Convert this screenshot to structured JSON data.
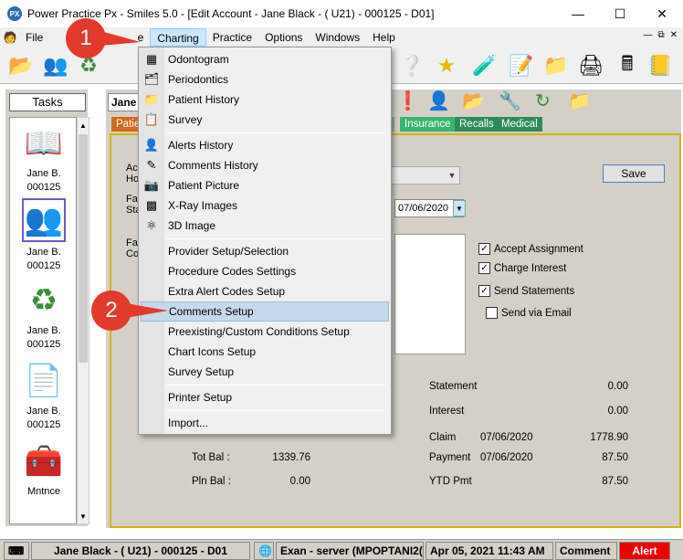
{
  "window": {
    "app_badge": "PX",
    "title": "Power Practice Px - Smiles 5.0 - [Edit Account - Jane Black - ( U21) - 000125 - D01]"
  },
  "menubar": {
    "items": [
      "File",
      "Edit",
      "Charting",
      "Practice",
      "Options",
      "Windows",
      "Help"
    ],
    "file_visible": "File",
    "edit_partial": "e",
    "active": "Charting"
  },
  "tasks": {
    "title": "Tasks",
    "items": [
      {
        "name": "Jane B.",
        "id": "000125",
        "icon": "ledger-book-icon"
      },
      {
        "name": "Jane B.",
        "id": "000125",
        "icon": "patients-icon"
      },
      {
        "name": "Jane B.",
        "id": "000125",
        "icon": "recycle-icon"
      },
      {
        "name": "Jane B.",
        "id": "000125",
        "icon": "document-icon"
      },
      {
        "name": "Mntnce",
        "id": "",
        "icon": "toolbox-icon"
      }
    ]
  },
  "main": {
    "patient_name": "Jane",
    "tabs": {
      "patient": "Patie",
      "r": "r",
      "insurance": "Insurance",
      "recalls": "Recalls",
      "medical": "Medical"
    },
    "fragments": {
      "ac": "Ac",
      "ho": "Ho",
      "fa1": "Fa",
      "sta": "Sta",
      "fa2": "Fa",
      "co": "Co"
    },
    "date_value": "07/06/2020",
    "save_label": "Save",
    "checkboxes": [
      {
        "label": "Accept Assignment",
        "checked": true
      },
      {
        "label": "Charge Interest",
        "checked": true
      },
      {
        "label": "Send Statements",
        "checked": true
      },
      {
        "label": "Send via Email",
        "checked": false
      }
    ],
    "balances": {
      "tot_bal_label": "Tot Bal :",
      "tot_bal_value": "1339.76",
      "pln_bal_label": "Pln Bal :",
      "pln_bal_value": "0.00"
    },
    "summary": {
      "statement_label": "Statement",
      "statement_value": "0.00",
      "interest_label": "Interest",
      "interest_value": "0.00",
      "claim_label": "Claim",
      "claim_date": "07/06/2020",
      "claim_value": "1778.90",
      "payment_label": "Payment",
      "payment_date": "07/06/2020",
      "payment_value": "87.50",
      "ytd_label": "YTD Pmt",
      "ytd_value": "87.50"
    }
  },
  "dropdown": {
    "groups": [
      [
        {
          "label": "Odontogram",
          "icon": "grid-chart-icon"
        },
        {
          "label": "Periodontics",
          "icon": "perio-icon"
        },
        {
          "label": "Patient History",
          "icon": "history-icon"
        },
        {
          "label": "Survey",
          "icon": "survey-icon"
        }
      ],
      [
        {
          "label": "Alerts History",
          "icon": "alert-person-icon"
        },
        {
          "label": "Comments History",
          "icon": "comment-pen-icon"
        },
        {
          "label": "Patient Picture",
          "icon": "camera-icon"
        },
        {
          "label": "X-Ray Images",
          "icon": "xray-icon"
        },
        {
          "label": "3D Image",
          "icon": "3d-image-icon"
        }
      ],
      [
        {
          "label": "Provider Setup/Selection",
          "icon": ""
        },
        {
          "label": "Procedure Codes Settings",
          "icon": ""
        },
        {
          "label": "Extra Alert Codes Setup",
          "icon": ""
        },
        {
          "label": "Comments Setup",
          "icon": "",
          "highlighted": true
        },
        {
          "label": "Preexisting/Custom Conditions Setup",
          "icon": ""
        },
        {
          "label": "Chart Icons Setup",
          "icon": ""
        },
        {
          "label": "Survey Setup",
          "icon": ""
        }
      ],
      [
        {
          "label": "Printer Setup",
          "icon": ""
        }
      ],
      [
        {
          "label": "Import...",
          "icon": ""
        }
      ]
    ]
  },
  "callouts": [
    "1",
    "2"
  ],
  "statusbar": {
    "patient": "Jane Black - ( U21) - 000125 - D01",
    "server": "Exan - server (MPOPTANI2(",
    "datetime": "Apr 05, 2021 11:43 AM",
    "comment": "Comment",
    "alert": "Alert"
  },
  "colors": {
    "accent_highlight": "#cce8ff",
    "callout_red": "#e23a2c",
    "alert_red": "#e00000",
    "panel_border": "#d2b500"
  }
}
